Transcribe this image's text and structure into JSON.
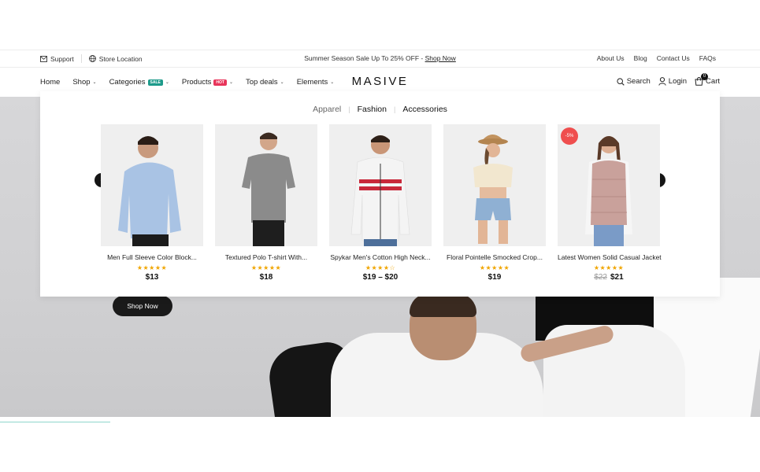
{
  "topbar": {
    "support": "Support",
    "store_location": "Store Location",
    "promo_text": "Summer Season Sale Up To 25% OFF - ",
    "promo_link": "Shop Now",
    "links": [
      "About Us",
      "Blog",
      "Contact Us",
      "FAQs"
    ]
  },
  "nav": {
    "home": "Home",
    "shop": "Shop",
    "categories": "Categories",
    "categories_badge": "SALE",
    "products": "Products",
    "products_badge": "HOT",
    "top_deals": "Top deals",
    "elements": "Elements",
    "logo": "MASIVE",
    "search": "Search",
    "login": "Login",
    "cart": "Cart",
    "cart_count": "0"
  },
  "mega": {
    "tabs": [
      "Apparel",
      "Fashion",
      "Accessories"
    ],
    "active_tab": "Fashion",
    "products": [
      {
        "name": "Men Full Sleeve Color Block...",
        "rating": 5,
        "stars": "★★★★★",
        "price": "$13",
        "old_price": "",
        "badge": ""
      },
      {
        "name": "Textured Polo T-shirt With...",
        "rating": 5,
        "stars": "★★★★★",
        "price": "$18",
        "old_price": "",
        "badge": ""
      },
      {
        "name": "Spykar Men's Cotton High Neck...",
        "rating": 4,
        "stars": "★★★★☆",
        "price": "$19 – $20",
        "old_price": "",
        "badge": ""
      },
      {
        "name": "Floral Pointelle Smocked Crop...",
        "rating": 5,
        "stars": "★★★★★",
        "price": "$19",
        "old_price": "",
        "badge": ""
      },
      {
        "name": "Latest Women Solid Casual Jacket",
        "rating": 5,
        "stars": "★★★★★",
        "price": "$21",
        "old_price": "$22",
        "badge": "-5%"
      }
    ]
  },
  "hero": {
    "cta": "Shop Now"
  },
  "colors": {
    "accent_sale": "#1d9a8a",
    "accent_hot": "#e8345a",
    "star": "#f0a500",
    "discount": "#ef4e4e"
  }
}
